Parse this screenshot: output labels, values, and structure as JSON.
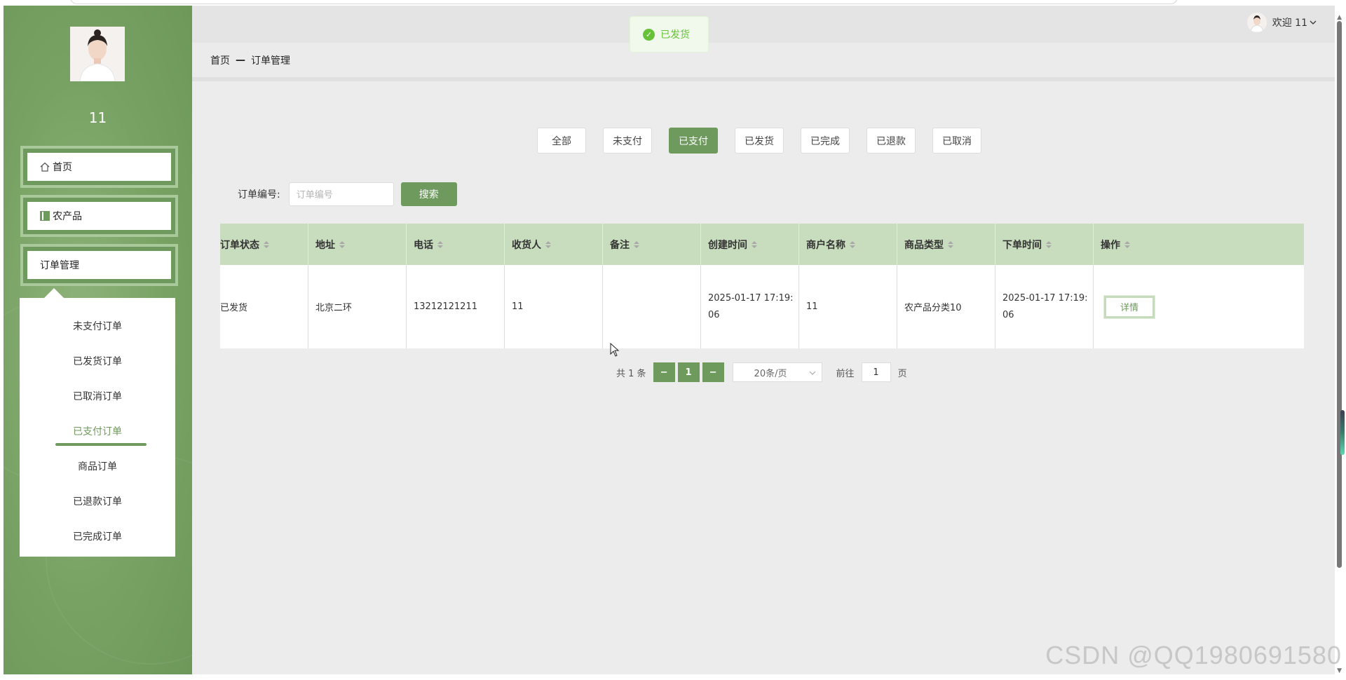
{
  "sidebar": {
    "username": "11",
    "menu": [
      {
        "label": "首页",
        "icon": "home-icon"
      },
      {
        "label": "农产品",
        "icon": "product-icon"
      },
      {
        "label": "订单管理",
        "icon": ""
      }
    ],
    "submenu": [
      {
        "label": "未支付订单",
        "active": false
      },
      {
        "label": "已发货订单",
        "active": false
      },
      {
        "label": "已取消订单",
        "active": false
      },
      {
        "label": "已支付订单",
        "active": true
      },
      {
        "label": "商品订单",
        "active": false
      },
      {
        "label": "已退款订单",
        "active": false
      },
      {
        "label": "已完成订单",
        "active": false
      }
    ]
  },
  "header": {
    "welcome": "欢迎 11",
    "breadcrumb": {
      "home": "首页",
      "sep": "—",
      "current": "订单管理"
    }
  },
  "toast": {
    "text": "已发货"
  },
  "tabs": [
    "全部",
    "未支付",
    "已支付",
    "已发货",
    "已完成",
    "已退款",
    "已取消"
  ],
  "active_tab": "已支付",
  "search": {
    "label": "订单编号:",
    "placeholder": "订单编号",
    "value": "",
    "button": "搜索"
  },
  "table": {
    "columns": [
      "订单状态",
      "地址",
      "电话",
      "收货人",
      "备注",
      "创建时间",
      "商户名称",
      "商品类型",
      "下单时间",
      "操作"
    ],
    "rows": [
      {
        "status": "已发货",
        "address": "北京二环",
        "phone": "13212121211",
        "consignee": "11",
        "remark": "",
        "created_line1": "2025-01-17 17:19:",
        "created_line2": "06",
        "merchant": "11",
        "category": "农产品分类10",
        "ordered_line1": "2025-01-17 17:19:",
        "ordered_line2": "06",
        "action": "详情"
      }
    ]
  },
  "pagination": {
    "total": "共 1 条",
    "prev": "−",
    "page": "1",
    "next": "−",
    "page_size": "20条/页",
    "goto_label": "前往",
    "goto_value": "1",
    "page_suffix": "页"
  },
  "watermark": "CSDN @QQ1980691580",
  "colors": {
    "accent": "#6f9a5d",
    "header_row": "#c8dcbe",
    "toast_green": "#67c23a"
  }
}
